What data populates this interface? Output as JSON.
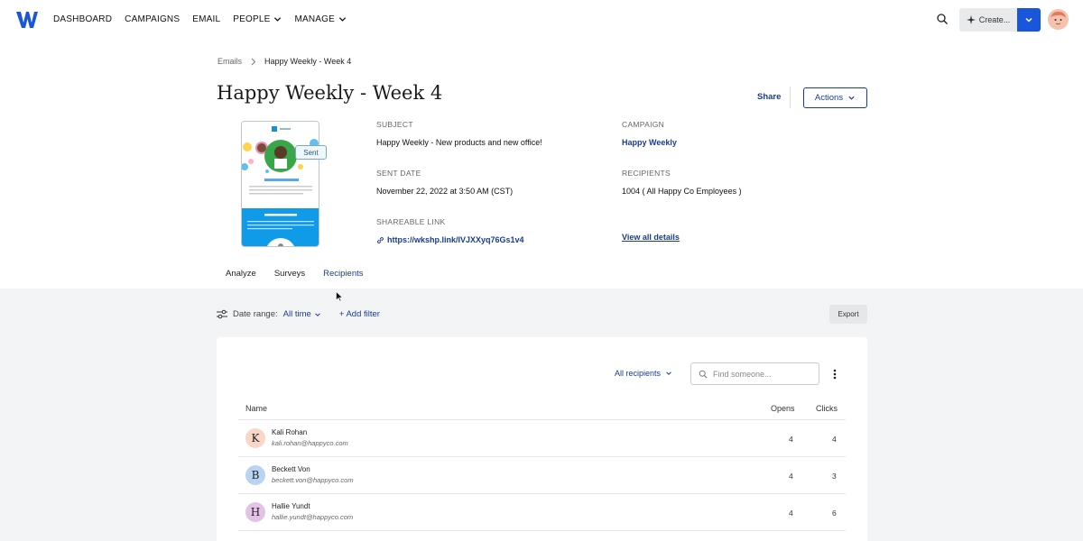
{
  "nav": {
    "items": [
      {
        "label": "DASHBOARD",
        "dropdown": false
      },
      {
        "label": "CAMPAIGNS",
        "dropdown": false
      },
      {
        "label": "EMAIL",
        "dropdown": false
      },
      {
        "label": "PEOPLE",
        "dropdown": true
      },
      {
        "label": "MANAGE",
        "dropdown": true
      }
    ],
    "create_label": "Create...",
    "brand_color": "#1a56db"
  },
  "breadcrumb": {
    "parent": "Emails",
    "current": "Happy Weekly - Week 4"
  },
  "page": {
    "title": "Happy Weekly - Week 4",
    "share_label": "Share",
    "actions_label": "Actions"
  },
  "preview": {
    "brand": "Happy Co",
    "greeting": "Happy Monday!",
    "section": "Meet the new hires!",
    "badge": "Sent"
  },
  "details": {
    "subject_label": "SUBJECT",
    "subject": "Happy Weekly - New products and new office!",
    "campaign_label": "CAMPAIGN",
    "campaign": "Happy Weekly",
    "sent_label": "SENT DATE",
    "sent": "November 22, 2022 at 3:50 AM (CST)",
    "recipients_label": "RECIPIENTS",
    "recipients": "1004 ( All Happy Co Employees )",
    "link_label": "SHAREABLE LINK",
    "link": "https://wkshp.link/IVJXXyq76Gs1v4",
    "view_all": "View all details"
  },
  "tabs": [
    {
      "label": "Analyze",
      "active": false
    },
    {
      "label": "Surveys",
      "active": false
    },
    {
      "label": "Recipients",
      "active": true
    }
  ],
  "filters": {
    "date_label": "Date range:",
    "date_value": "All time",
    "add_filter": "+ Add filter",
    "export": "Export"
  },
  "table": {
    "filter_select": "All recipients",
    "search_placeholder": "Find someone...",
    "columns": {
      "name": "Name",
      "opens": "Opens",
      "clicks": "Clicks"
    },
    "rows": [
      {
        "initial": "K",
        "name": "Kali Rohan",
        "email": "kali.rohan@happyco.com",
        "opens": "4",
        "clicks": "4",
        "color": "#f8d6c8"
      },
      {
        "initial": "B",
        "name": "Beckett Von",
        "email": "beckett.von@happyco.com",
        "opens": "4",
        "clicks": "3",
        "color": "#b9d3f2"
      },
      {
        "initial": "H",
        "name": "Hallie Yundt",
        "email": "hallie.yundt@happyco.com",
        "opens": "4",
        "clicks": "6",
        "color": "#e4c1e6"
      }
    ]
  }
}
